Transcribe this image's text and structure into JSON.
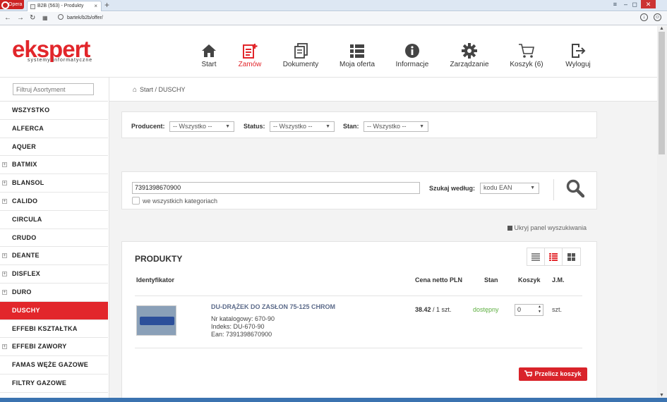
{
  "browser": {
    "opera_label": "Opera",
    "tab_title": "B2B (563) - Produkty",
    "url": "bartek/b2b/offer/"
  },
  "header": {
    "logo_text": "ekspert",
    "logo_subtext": "systemy informatyczne",
    "nav": [
      {
        "label": "Start",
        "icon": "home-icon"
      },
      {
        "label": "Zamów",
        "icon": "order-icon"
      },
      {
        "label": "Dokumenty",
        "icon": "documents-icon"
      },
      {
        "label": "Moja oferta",
        "icon": "list-icon"
      },
      {
        "label": "Informacje",
        "icon": "info-icon"
      },
      {
        "label": "Zarządzanie",
        "icon": "gear-icon"
      },
      {
        "label": "Koszyk (6)",
        "icon": "cart-icon"
      },
      {
        "label": "Wyloguj",
        "icon": "logout-icon"
      }
    ]
  },
  "sidebar": {
    "filter_placeholder": "Filtruj Asortyment",
    "items": [
      {
        "label": "WSZYSTKO",
        "expandable": false
      },
      {
        "label": "ALFERCA",
        "expandable": false
      },
      {
        "label": "AQUER",
        "expandable": false
      },
      {
        "label": "BATMIX",
        "expandable": true
      },
      {
        "label": "BLANSOL",
        "expandable": true
      },
      {
        "label": "CALIDO",
        "expandable": true
      },
      {
        "label": "CIRCULA",
        "expandable": false
      },
      {
        "label": "CRUDO",
        "expandable": false
      },
      {
        "label": "DEANTE",
        "expandable": true
      },
      {
        "label": "DISFLEX",
        "expandable": true
      },
      {
        "label": "DURO",
        "expandable": true
      },
      {
        "label": "DUSCHY",
        "expandable": false,
        "active": true
      },
      {
        "label": "EFFEBI KSZTAŁTKA",
        "expandable": false
      },
      {
        "label": "EFFEBI ZAWORY",
        "expandable": true
      },
      {
        "label": "FAMAS WĘŻE GAZOWE",
        "expandable": false
      },
      {
        "label": "FILTRY GAZOWE",
        "expandable": false
      }
    ]
  },
  "breadcrumb": "Start / DUSCHY",
  "filters": {
    "producer_label": "Producent:",
    "producer_value": "-- Wszystko --",
    "status_label": "Status:",
    "status_value": "-- Wszystko --",
    "state_label": "Stan:",
    "state_value": "-- Wszystko --"
  },
  "search": {
    "value": "7391398670900",
    "all_categories_label": "we wszystkich kategoriach",
    "search_by_label": "Szukaj według:",
    "search_by_value": "kodu EAN"
  },
  "hide_panel_label": "Ukryj panel wyszukiwania",
  "products": {
    "title": "PRODUKTY",
    "columns": [
      "Identyfikator",
      "Cena netto PLN",
      "Stan",
      "Koszyk",
      "J.M."
    ],
    "rows": [
      {
        "name": "DU-DRĄŻEK DO ZASŁON 75-125 CHROM",
        "catalog_no": "Nr katalogowy: 670-90",
        "index": "Indeks: DU-670-90",
        "ean": "Ean: 7391398670900",
        "price": "38.42",
        "price_unit": "/ 1 szt.",
        "stock": "dostępny",
        "qty": "0",
        "unit": "szt."
      }
    ],
    "recalc_button": "Przelicz koszyk"
  },
  "colors": {
    "accent": "#e2262b",
    "stock_ok": "#5cae3f"
  }
}
